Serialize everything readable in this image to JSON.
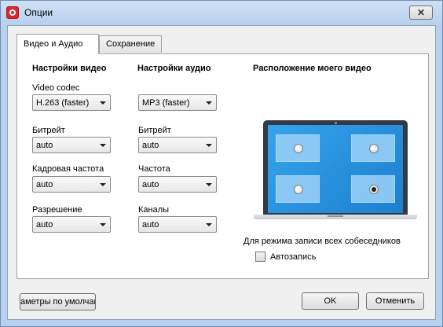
{
  "window": {
    "title": "Опции",
    "close_glyph": "✕"
  },
  "tabs": [
    {
      "label": "Видео и Аудио",
      "active": true
    },
    {
      "label": "Сохранение",
      "active": false
    }
  ],
  "video": {
    "heading": "Настройки видео",
    "fields": [
      {
        "label": "Video codec",
        "value": "H.263 (faster)"
      },
      {
        "label": "Битрейт",
        "value": "auto"
      },
      {
        "label": "Кадровая частота",
        "value": "auto"
      },
      {
        "label": "Разрешение",
        "value": "auto"
      }
    ]
  },
  "audio": {
    "heading": "Настройки аудио",
    "fields": [
      {
        "label": "",
        "value": "MP3 (faster)"
      },
      {
        "label": "Битрейт",
        "value": "auto"
      },
      {
        "label": "Частота",
        "value": "auto"
      },
      {
        "label": "Каналы",
        "value": "auto"
      }
    ]
  },
  "position": {
    "heading": "Расположение моего видео",
    "positions": [
      "top-left",
      "top-right",
      "bottom-left",
      "bottom-right"
    ],
    "selected": "bottom-right",
    "record_all_label": "Для режима записи всех собеседников",
    "autorecord_label": "Автозапись",
    "autorecord_checked": false
  },
  "footer": {
    "defaults_label": "аметры по умолчан",
    "ok_label": "OK",
    "cancel_label": "Отменить"
  },
  "colors": {
    "screen": "#2a94e2",
    "accent": "#e0242a"
  }
}
